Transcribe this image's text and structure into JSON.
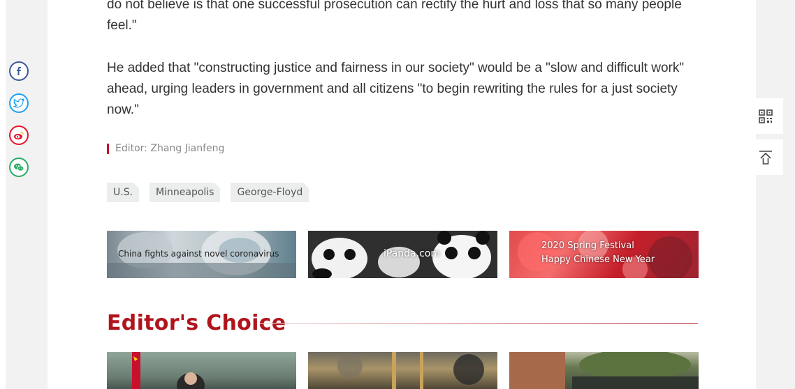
{
  "article": {
    "paragraph_1": "do not believe is that one successful prosecution can rectify the hurt and loss that so many people feel.\"",
    "paragraph_2": "He added that \"constructing justice and fairness in our society\" would be a \"slow and difficult work\" ahead, urging leaders in government and all citizens \"to begin rewriting the rules for a just society now.\""
  },
  "editor": {
    "text": "Editor: Zhang Jianfeng"
  },
  "tags": [
    "U.S.",
    "Minneapolis",
    "George-Floyd"
  ],
  "banners": [
    {
      "label": "China fights against novel coronavirus"
    },
    {
      "label": "iPanda.com"
    },
    {
      "label_line1": "2020 Spring Festival",
      "label_line2": "Happy Chinese New Year"
    }
  ],
  "editors_choice": {
    "title": "Editor's Choice"
  },
  "share": [
    "facebook-icon",
    "twitter-icon",
    "weibo-icon",
    "wechat-icon"
  ],
  "side_tools": [
    "qr-code-icon",
    "back-to-top-icon"
  ],
  "colors": {
    "accent_red": "#b0151d",
    "editor_bar": "#c8102e"
  }
}
